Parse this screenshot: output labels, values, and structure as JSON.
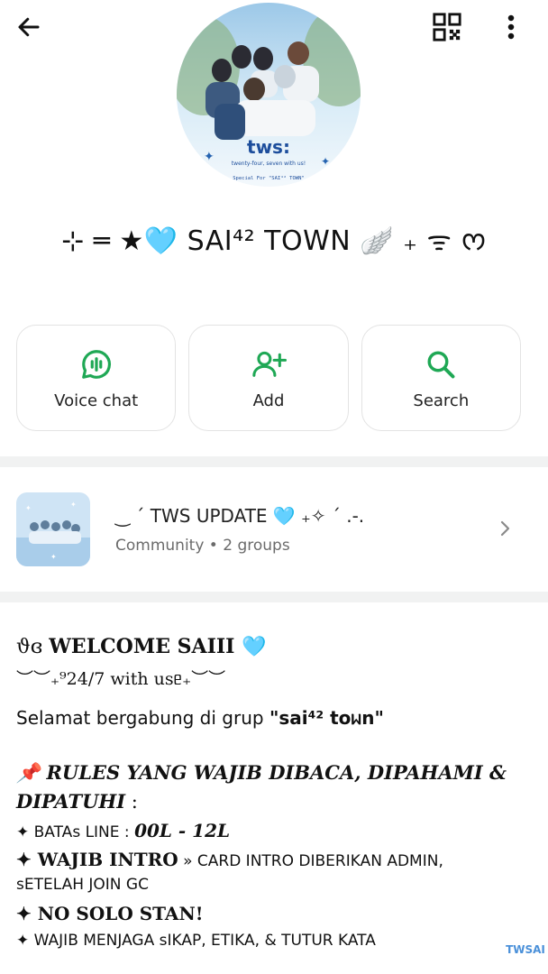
{
  "header": {
    "back_icon": "arrow-left-icon",
    "qr_icon": "qr-code-icon",
    "more_icon": "more-vertical-icon"
  },
  "avatar": {
    "title": "tws:",
    "tagline": "twenty-four, seven with us!",
    "special_text": "Special For \"SAI⁴² TOWN\""
  },
  "group": {
    "name": "⊹ ═ ★🩵 SAI⁴² TOWN 🪽 ₊ ᯤ ᰔ"
  },
  "actions": [
    {
      "label": "Voice chat",
      "icon": "voice-chat-icon"
    },
    {
      "label": "Add",
      "icon": "add-person-icon"
    },
    {
      "label": "Search",
      "icon": "search-icon"
    }
  ],
  "community": {
    "title": "‿ ´ TWS UPDATE 🩵 ₊✧ ´ .-.",
    "subtitle": "Community • 2 groups"
  },
  "description": {
    "l1_prefix": "ϑɞ ",
    "l1": "WELCOME SAIII 🩵",
    "l2": "︶︶₊⁹24/7 with usᥱ₊︶︶",
    "l3_a": "Selamat bergabung di grup ",
    "l3_b": "\"sai⁴² toᥕn\"",
    "l4": "📌 RULES YANG WAJIB DIBACA, DIPAHAMI &",
    "l5": "DIPATUHI",
    "l5_colon": " :",
    "l6_a": "✦ BATAs LINE : ",
    "l6_b": "00L - 12L",
    "l7_a": "✦ WAJIB INTRO",
    "l7_b": " » CARD INTRO DIBERIKAN ADMIN,",
    "l8": "sETELAH JOIN GC",
    "l9": "✦ NO SOLO STAN!",
    "l10_a": "✦ ",
    "l10_b": "WAJIB MENJAGA sIKAP, ETIKA, & TUTUR KATA"
  },
  "watermark": "TWSAI",
  "colors": {
    "accent_green": "#1fa855",
    "card_border": "#e3e3e3",
    "band_gray": "#f1f2f2"
  }
}
